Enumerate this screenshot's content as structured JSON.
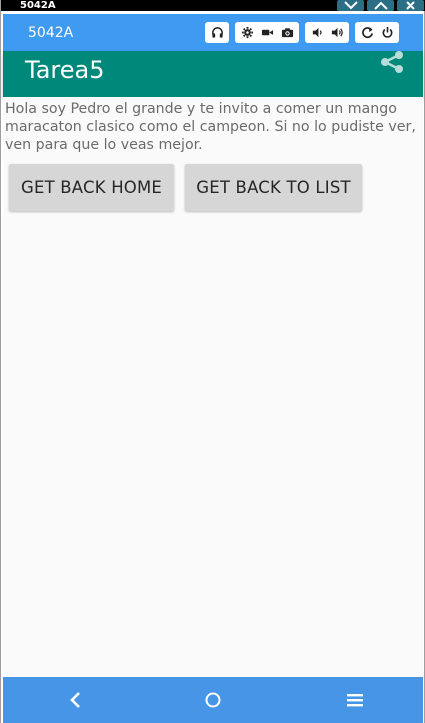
{
  "window": {
    "title": "5042A"
  },
  "emulator": {
    "device_name": "5042A"
  },
  "app_bar": {
    "title": "Tarea5",
    "share_icon": "share-icon"
  },
  "content": {
    "message": "Hola soy Pedro el grande y te invito a comer un mango maracaton clasico como el campeon. Si no lo pudiste ver, ven para que lo veas mejor.",
    "buttons": {
      "home_label": "GET BACK HOME",
      "list_label": "GET BACK TO LIST"
    }
  },
  "colors": {
    "app_bar": "#00897b",
    "toolbar": "#3f9bf2",
    "nav_bar": "#4695e6",
    "button": "#d6d6d6"
  }
}
